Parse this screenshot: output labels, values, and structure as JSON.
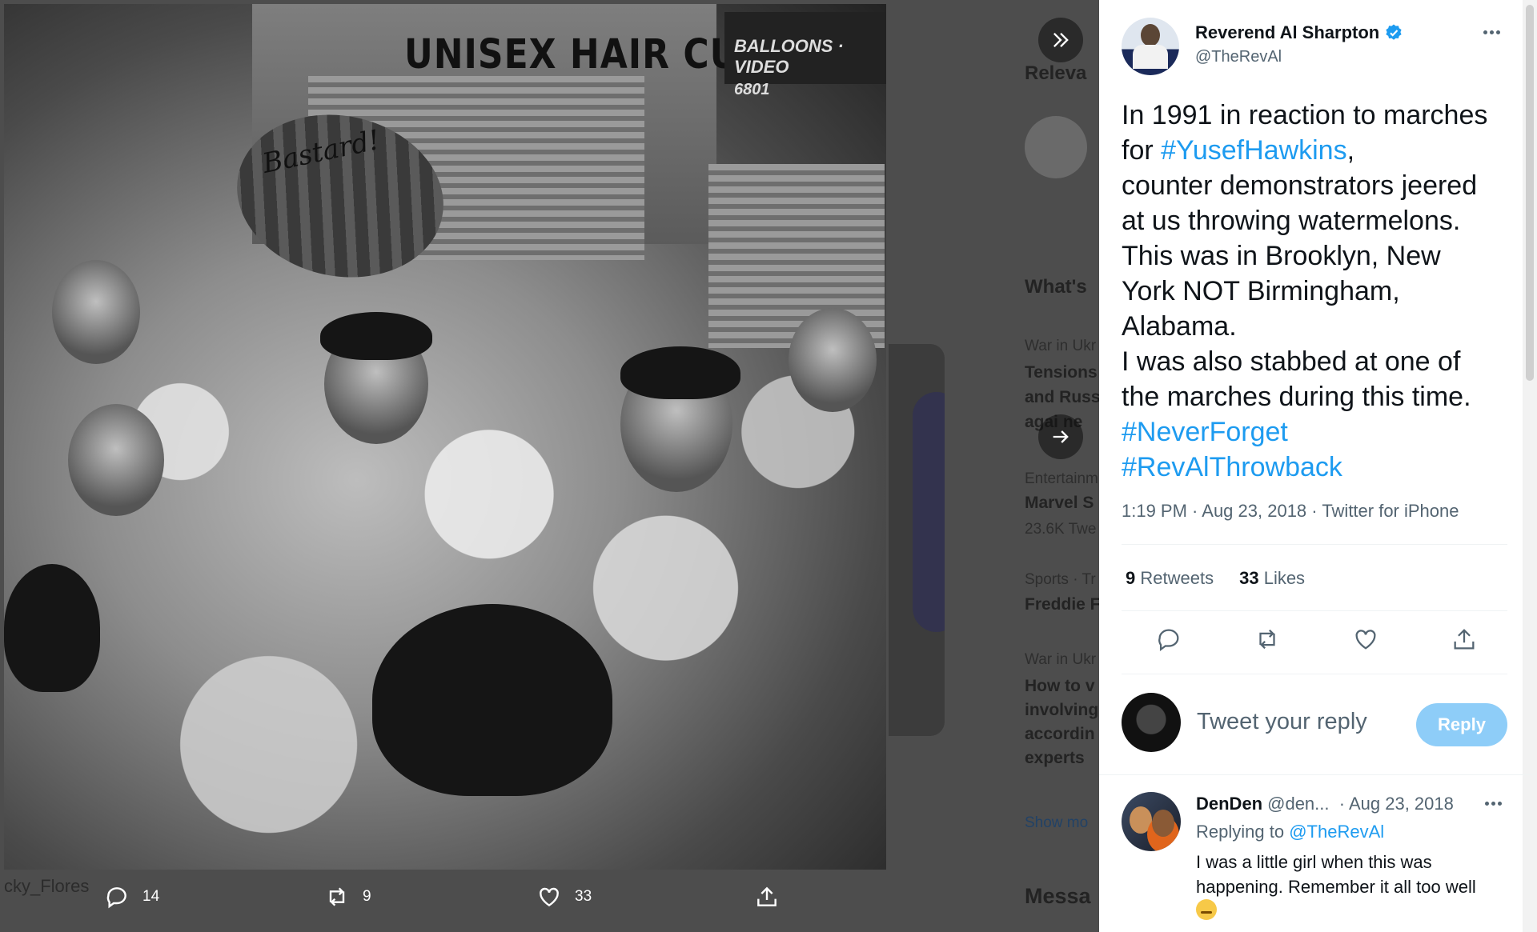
{
  "photo": {
    "shop_sign": "UNISEX HAIR CUTTING",
    "sign2_line1": "BALLOONS · VIDEO",
    "sign2_line2": "6801",
    "melon_text": "Bastard!",
    "watermark": "cky_Flores"
  },
  "media_actions": {
    "reply_count": "14",
    "retweet_count": "9",
    "like_count": "33",
    "share_icon": "share-icon"
  },
  "background_page": {
    "relevant": "Releva",
    "whats": "What's",
    "item1_cat": "War in Ukr",
    "item1_l1": "Tensions",
    "item1_l2": "and Russ",
    "item1_l3": "agai ne",
    "item2_cat": "Entertainm",
    "item2_title": "Marvel S",
    "item2_count": "23.6K Twe",
    "item3_cat": "Sports · Tr",
    "item3_title": "Freddie F",
    "item4_cat": "War in Ukr",
    "item4_l1": "How to v",
    "item4_l2": "involving",
    "item4_l3": "accordin",
    "item4_l4": "experts",
    "show_more": "Show mo",
    "messages": "Messa"
  },
  "tweet": {
    "name": "Reverend Al Sharpton",
    "handle": "@TheRevAl",
    "lines": [
      {
        "text": "In 1991 in reaction to marches"
      },
      {
        "pre": "for ",
        "tag": "#YusefHawkins",
        "post": ","
      },
      {
        "text": "counter demonstrators jeered"
      },
      {
        "text": "at us throwing watermelons."
      },
      {
        "text": "This was in Brooklyn, New"
      },
      {
        "text": "York NOT Birmingham,"
      },
      {
        "text": "Alabama."
      },
      {
        "text": "I was also stabbed at one of"
      },
      {
        "text": "the marches during this time."
      }
    ],
    "hashtag1": "#NeverForget",
    "hashtag2": "#RevAlThrowback",
    "meta": "1:19 PM · Aug 23, 2018 · Twitter for iPhone",
    "retweets_count": "9",
    "retweets_label": "Retweets",
    "likes_count": "33",
    "likes_label": "Likes"
  },
  "reply_box": {
    "placeholder": "Tweet your reply",
    "button": "Reply"
  },
  "reply": {
    "name": "DenDen",
    "handle": "@den...",
    "date": "· Aug 23, 2018",
    "replying_to_label": "Replying to",
    "replying_to_handle": "@TheRevAl",
    "line1": "I was a little girl when this was",
    "line2": "happening. Remember it all too well"
  },
  "colors": {
    "accent": "#1d9bf0",
    "reply_button": "#8ecdf8",
    "overlay": "#4d4d4d"
  }
}
